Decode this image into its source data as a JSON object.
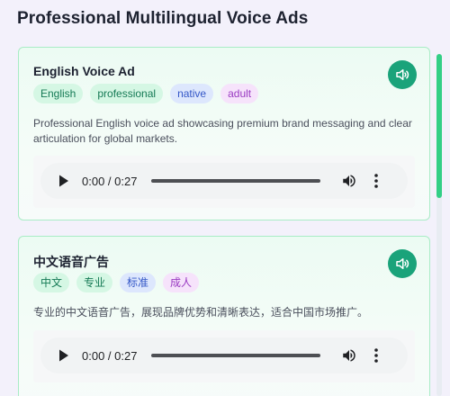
{
  "page": {
    "title": "Professional Multilingual Voice Ads"
  },
  "ads": [
    {
      "title": "English Voice Ad",
      "tags": [
        {
          "label": "English",
          "color": "green"
        },
        {
          "label": "professional",
          "color": "green"
        },
        {
          "label": "native",
          "color": "blue"
        },
        {
          "label": "adult",
          "color": "purple"
        }
      ],
      "description": "Professional English voice ad showcasing premium brand messaging and clear articulation for global markets.",
      "player": {
        "time": "0:00 / 0:27",
        "progress": 0
      }
    },
    {
      "title": "中文语音广告",
      "tags": [
        {
          "label": "中文",
          "color": "green"
        },
        {
          "label": "专业",
          "color": "green"
        },
        {
          "label": "标准",
          "color": "blue"
        },
        {
          "label": "成人",
          "color": "purple"
        }
      ],
      "description": "专业的中文语音广告，展现品牌优势和清晰表达，适合中国市场推广。",
      "player": {
        "time": "0:00 / 0:27",
        "progress": 0
      }
    }
  ],
  "theme": {
    "accent": "#1aa37a",
    "card_border": "#a9ecc6",
    "scrollbar": "#33cf86"
  },
  "icons": {
    "speaker": "volume-icon",
    "play": "play-icon",
    "volume": "volume-icon",
    "more": "more-vert-icon"
  }
}
